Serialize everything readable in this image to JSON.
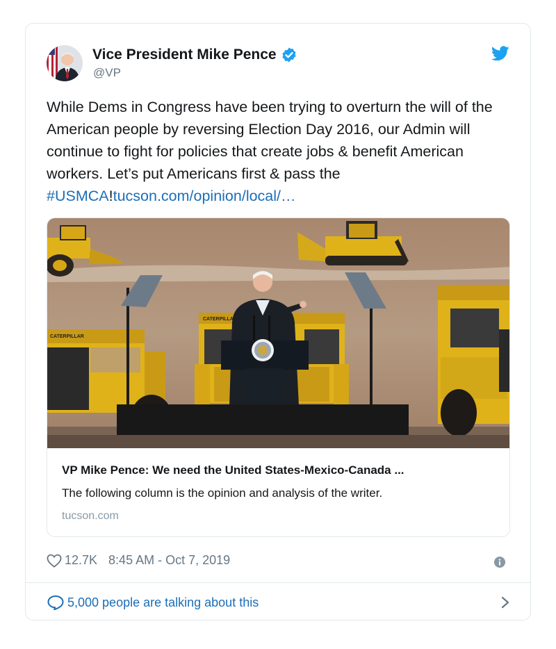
{
  "tweet": {
    "author_name": "Vice President Mike Pence",
    "handle": "@VP",
    "verified_icon": "verified-badge-icon",
    "brand_icon": "twitter-bird-icon",
    "text_main": "While Dems in Congress have been trying to overturn the will of the American people by reversing Election Day 2016, our Admin will continue to fight for policies that create jobs & benefit American workers. Let’s put Americans first & pass the ",
    "hashtag": "#USMCA",
    "hashtag_suffix": "!",
    "link_text": "tucson.com/opinion/local/…",
    "link_color": "#1b6eb8"
  },
  "link_card": {
    "title": "VP Mike Pence: We need the United States-Mexico-Canada ...",
    "description": "The following column is the opinion and analysis of the writer.",
    "domain": "tucson.com",
    "image_alt": "Mike Pence speaking at a podium in front of yellow Caterpillar mining trucks"
  },
  "meta": {
    "like_icon": "heart-icon",
    "likes": "12.7K",
    "timestamp": "8:45 AM - Oct 7, 2019",
    "info_icon": "info-icon"
  },
  "footer": {
    "comment_icon": "comment-icon",
    "talking": "5,000 people are talking about this",
    "chevron_icon": "chevron-right-icon"
  }
}
